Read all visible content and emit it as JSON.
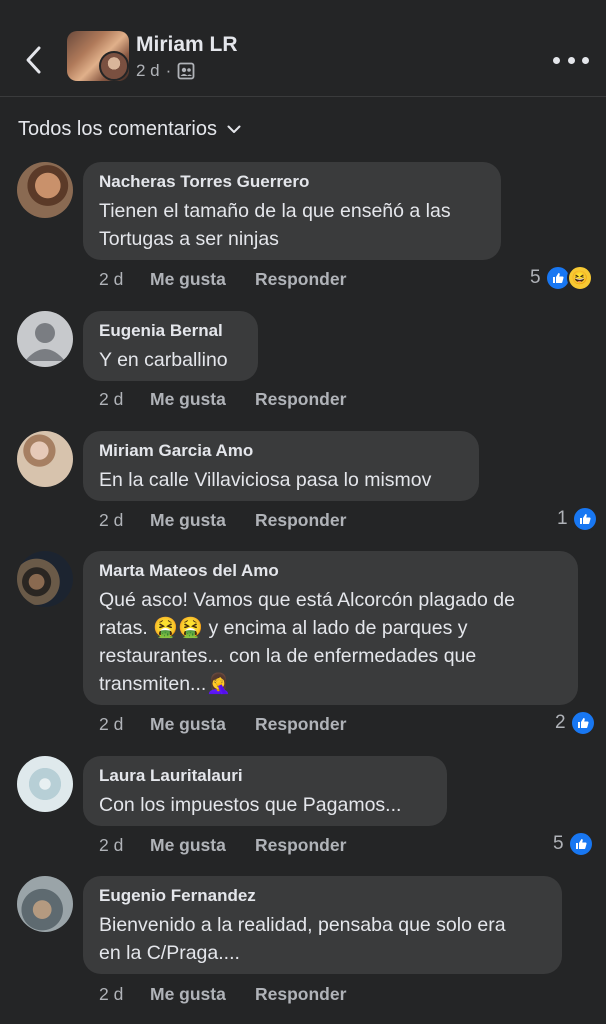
{
  "header": {
    "page_name": "Miriam LR",
    "time": "2 d",
    "separator": "·"
  },
  "filter": {
    "label": "Todos los comentarios"
  },
  "comments": [
    {
      "author": "Nacheras Torres Guerrero",
      "text_lines": [
        "Tienen el tamaño de la que enseñó a las",
        "Tortugas a ser ninjas"
      ],
      "time": "2 d",
      "like": "Me gusta",
      "reply": "Responder",
      "reaction_count": "5"
    },
    {
      "author": "Eugenia Bernal",
      "text_lines": [
        "Y en carballino"
      ],
      "time": "2 d",
      "like": "Me gusta",
      "reply": "Responder"
    },
    {
      "author": "Miriam Garcia Amo",
      "text_lines": [
        "En la calle Villaviciosa pasa lo mismov"
      ],
      "time": "2 d",
      "like": "Me gusta",
      "reply": "Responder",
      "reaction_count": "1"
    },
    {
      "author": "Marta Mateos del Amo",
      "text_lines": [
        "Qué asco! Vamos que está Alcorcón plagado de",
        "ratas.",
        "y encima al lado de parques y",
        "restaurantes... con la de enfermedades que",
        "transmiten..."
      ],
      "emojis": [
        "🤮",
        "🤮",
        "🤦‍♀️"
      ],
      "time": "2 d",
      "like": "Me gusta",
      "reply": "Responder",
      "reaction_count": "2"
    },
    {
      "author": "Laura Lauritalauri",
      "text_lines": [
        "Con los impuestos que Pagamos..."
      ],
      "time": "2 d",
      "like": "Me gusta",
      "reply": "Responder",
      "reaction_count": "5"
    },
    {
      "author": "Eugenio Fernandez",
      "text_lines": [
        "Bienvenido a la realidad, pensaba que solo era",
        "en la C/Praga...."
      ],
      "time": "2 d",
      "like": "Me gusta",
      "reply": "Responder"
    }
  ],
  "colors": {
    "background": "#242526",
    "bubble": "#3a3b3c",
    "like_blue": "#1877f2",
    "secondary_text": "#b0b3b8"
  }
}
